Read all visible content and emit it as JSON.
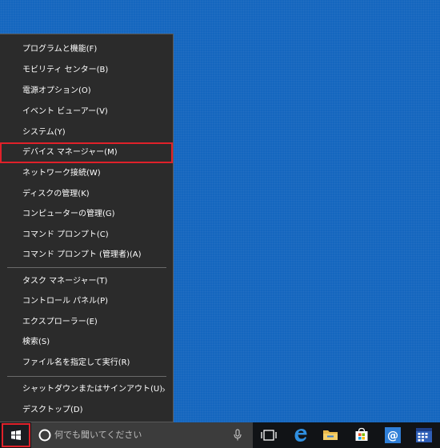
{
  "context_menu": {
    "groups": [
      {
        "items": [
          {
            "label": "プログラムと機能(F)"
          },
          {
            "label": "モビリティ センター(B)"
          },
          {
            "label": "電源オプション(O)"
          },
          {
            "label": "イベント ビューアー(V)"
          },
          {
            "label": "システム(Y)"
          },
          {
            "label": "デバイス マネージャー(M)",
            "highlighted": true
          },
          {
            "label": "ネットワーク接続(W)"
          },
          {
            "label": "ディスクの管理(K)"
          },
          {
            "label": "コンピューターの管理(G)"
          },
          {
            "label": "コマンド プロンプト(C)"
          },
          {
            "label": "コマンド プロンプト (管理者)(A)"
          }
        ]
      },
      {
        "items": [
          {
            "label": "タスク マネージャー(T)"
          },
          {
            "label": "コントロール パネル(P)"
          },
          {
            "label": "エクスプローラー(E)"
          },
          {
            "label": "検索(S)"
          },
          {
            "label": "ファイル名を指定して実行(R)"
          }
        ]
      },
      {
        "items": [
          {
            "label": "シャットダウンまたはサインアウト(U)",
            "has_submenu": true
          },
          {
            "label": "デスクトップ(D)"
          }
        ]
      }
    ],
    "submenu_arrow": "›"
  },
  "taskbar": {
    "search": {
      "placeholder": "何でも聞いてください",
      "icon": "cortana-circle-icon",
      "mic_icon": "microphone-icon"
    },
    "pinned": [
      {
        "name": "task-view",
        "icon": "task-view-icon"
      },
      {
        "name": "edge",
        "icon": "edge-icon"
      },
      {
        "name": "file-explorer",
        "icon": "folder-icon"
      },
      {
        "name": "store",
        "icon": "store-bag-icon"
      },
      {
        "name": "mail",
        "icon": "mail-at-icon"
      },
      {
        "name": "calendar",
        "icon": "calendar-icon"
      }
    ]
  },
  "colors": {
    "desktop": "#1566bf",
    "menu_background": "#2b2b2b",
    "taskbar": "#111316",
    "highlight": "#e0212a",
    "accent": "#2f7fd8"
  }
}
